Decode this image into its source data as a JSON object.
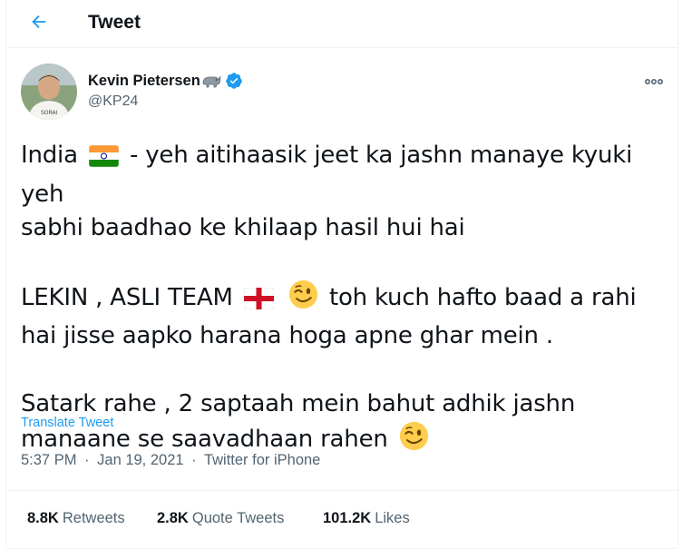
{
  "header": {
    "title": "Tweet",
    "back_icon": "arrow-left-icon"
  },
  "author": {
    "name": "Kevin Pietersen",
    "name_emoji": "rhino-emoji",
    "verified": true,
    "handle": "@KP24"
  },
  "tweet": {
    "paragraphs": [
      {
        "lines": [
          [
            "India ",
            "[flag-india]",
            " - yeh aitihaasik jeet ka jashn manaye kyuki yeh"
          ],
          [
            "sabhi baadhao ke khilaap hasil hui hai"
          ]
        ]
      },
      {
        "lines": [
          [
            "LEKIN , ASLI TEAM ",
            "[flag-england]",
            " ",
            "[winking-face]",
            " toh kuch hafto baad a rahi"
          ],
          [
            "hai jisse aapko harana hoga apne ghar mein ."
          ]
        ]
      },
      {
        "lines": [
          [
            "Satark rahe , 2 saptaah mein bahut adhik jashn"
          ],
          [
            "manaane se saavadhaan rahen ",
            "[winking-face]"
          ]
        ]
      }
    ],
    "p1_line1_a": "India",
    "p1_line1_b": "- yeh aitihaasik jeet ka jashn manaye kyuki yeh",
    "p1_line2": "sabhi baadhao ke khilaap hasil hui hai",
    "p2_line1_a": "LEKIN , ASLI TEAM",
    "p2_line1_b": "toh kuch hafto baad a rahi",
    "p2_line2": "hai jisse aapko harana hoga apne ghar mein .",
    "p3_line1": "Satark rahe , 2 saptaah mein bahut adhik jashn",
    "p3_line2": "manaane se saavadhaan rahen",
    "translate_label": "Translate Tweet"
  },
  "meta": {
    "time": "5:37 PM",
    "date": "Jan 19, 2021",
    "source": "Twitter for iPhone",
    "separator": "·"
  },
  "stats": {
    "retweets_count": "8.8K",
    "retweets_label": "Retweets",
    "quotes_count": "2.8K",
    "quotes_label": "Quote Tweets",
    "likes_count": "101.2K",
    "likes_label": "Likes"
  },
  "colors": {
    "accent": "#1d9bf0",
    "text": "#0f1419",
    "secondary": "#536471",
    "border": "#eff3f4"
  }
}
